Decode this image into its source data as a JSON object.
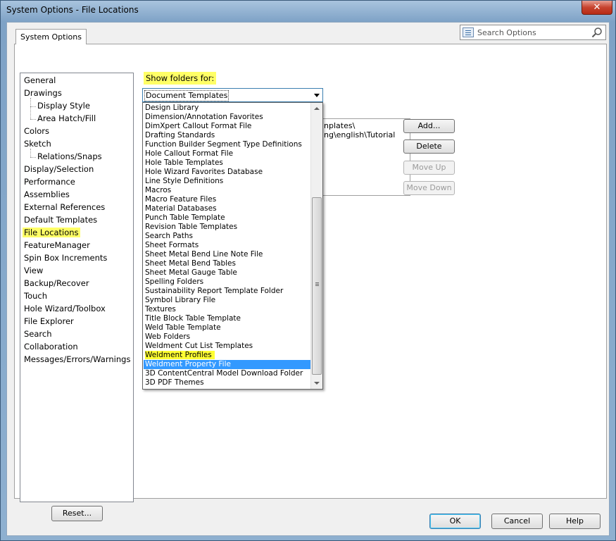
{
  "window": {
    "title": "System Options - File Locations",
    "close_glyph": "✕"
  },
  "tab": {
    "label": "System Options"
  },
  "search": {
    "placeholder": "Search Options"
  },
  "tree": {
    "items": [
      {
        "label": "General",
        "child": false
      },
      {
        "label": "Drawings",
        "child": false
      },
      {
        "label": "Display Style",
        "child": true
      },
      {
        "label": "Area Hatch/Fill",
        "child": true
      },
      {
        "label": "Colors",
        "child": false
      },
      {
        "label": "Sketch",
        "child": false
      },
      {
        "label": "Relations/Snaps",
        "child": true
      },
      {
        "label": "Display/Selection",
        "child": false
      },
      {
        "label": "Performance",
        "child": false
      },
      {
        "label": "Assemblies",
        "child": false
      },
      {
        "label": "External References",
        "child": false
      },
      {
        "label": "Default Templates",
        "child": false
      },
      {
        "label": "File Locations",
        "child": false,
        "highlight": true
      },
      {
        "label": "FeatureManager",
        "child": false
      },
      {
        "label": "Spin Box Increments",
        "child": false
      },
      {
        "label": "View",
        "child": false
      },
      {
        "label": "Backup/Recover",
        "child": false
      },
      {
        "label": "Touch",
        "child": false
      },
      {
        "label": "Hole Wizard/Toolbox",
        "child": false
      },
      {
        "label": "File Explorer",
        "child": false
      },
      {
        "label": "Search",
        "child": false
      },
      {
        "label": "Collaboration",
        "child": false
      },
      {
        "label": "Messages/Errors/Warnings",
        "child": false
      }
    ]
  },
  "reset_label": "Reset...",
  "show_folders": {
    "label": "Show folders for:",
    "selected": "Document Templates"
  },
  "folder_list": {
    "rows": [
      "nplates\\",
      "ng\\english\\Tutorial"
    ]
  },
  "side_buttons": {
    "add": "Add...",
    "delete": "Delete",
    "move_up": "Move Up",
    "move_down": "Move Down"
  },
  "dropdown": {
    "items": [
      "Design Library",
      "Dimension/Annotation Favorites",
      "DimXpert Callout Format File",
      "Drafting Standards",
      "Function Builder Segment Type Definitions",
      "Hole Callout Format File",
      "Hole Table Templates",
      "Hole Wizard Favorites Database",
      "Line Style Definitions",
      "Macros",
      "Macro Feature Files",
      "Material Databases",
      "Punch Table Template",
      "Revision Table Templates",
      "Search Paths",
      "Sheet Formats",
      "Sheet Metal Bend Line Note File",
      "Sheet Metal Bend Tables",
      "Sheet Metal Gauge Table",
      "Spelling Folders",
      "Sustainability Report Template Folder",
      "Symbol Library File",
      "Textures",
      "Title Block Table Template",
      "Weld Table Template",
      "Web Folders",
      "Weldment Cut List Templates",
      "Weldment Profiles",
      "Weldment Property File",
      "3D ContentCentral Model Download Folder",
      "3D PDF Themes"
    ],
    "highlighted_item": "Weldment Profiles",
    "selected_item": "Weldment Property File"
  },
  "footer": {
    "ok": "OK",
    "cancel": "Cancel",
    "help": "Help"
  },
  "colors": {
    "highlight": "#ffff66",
    "selection": "#3399ff"
  }
}
